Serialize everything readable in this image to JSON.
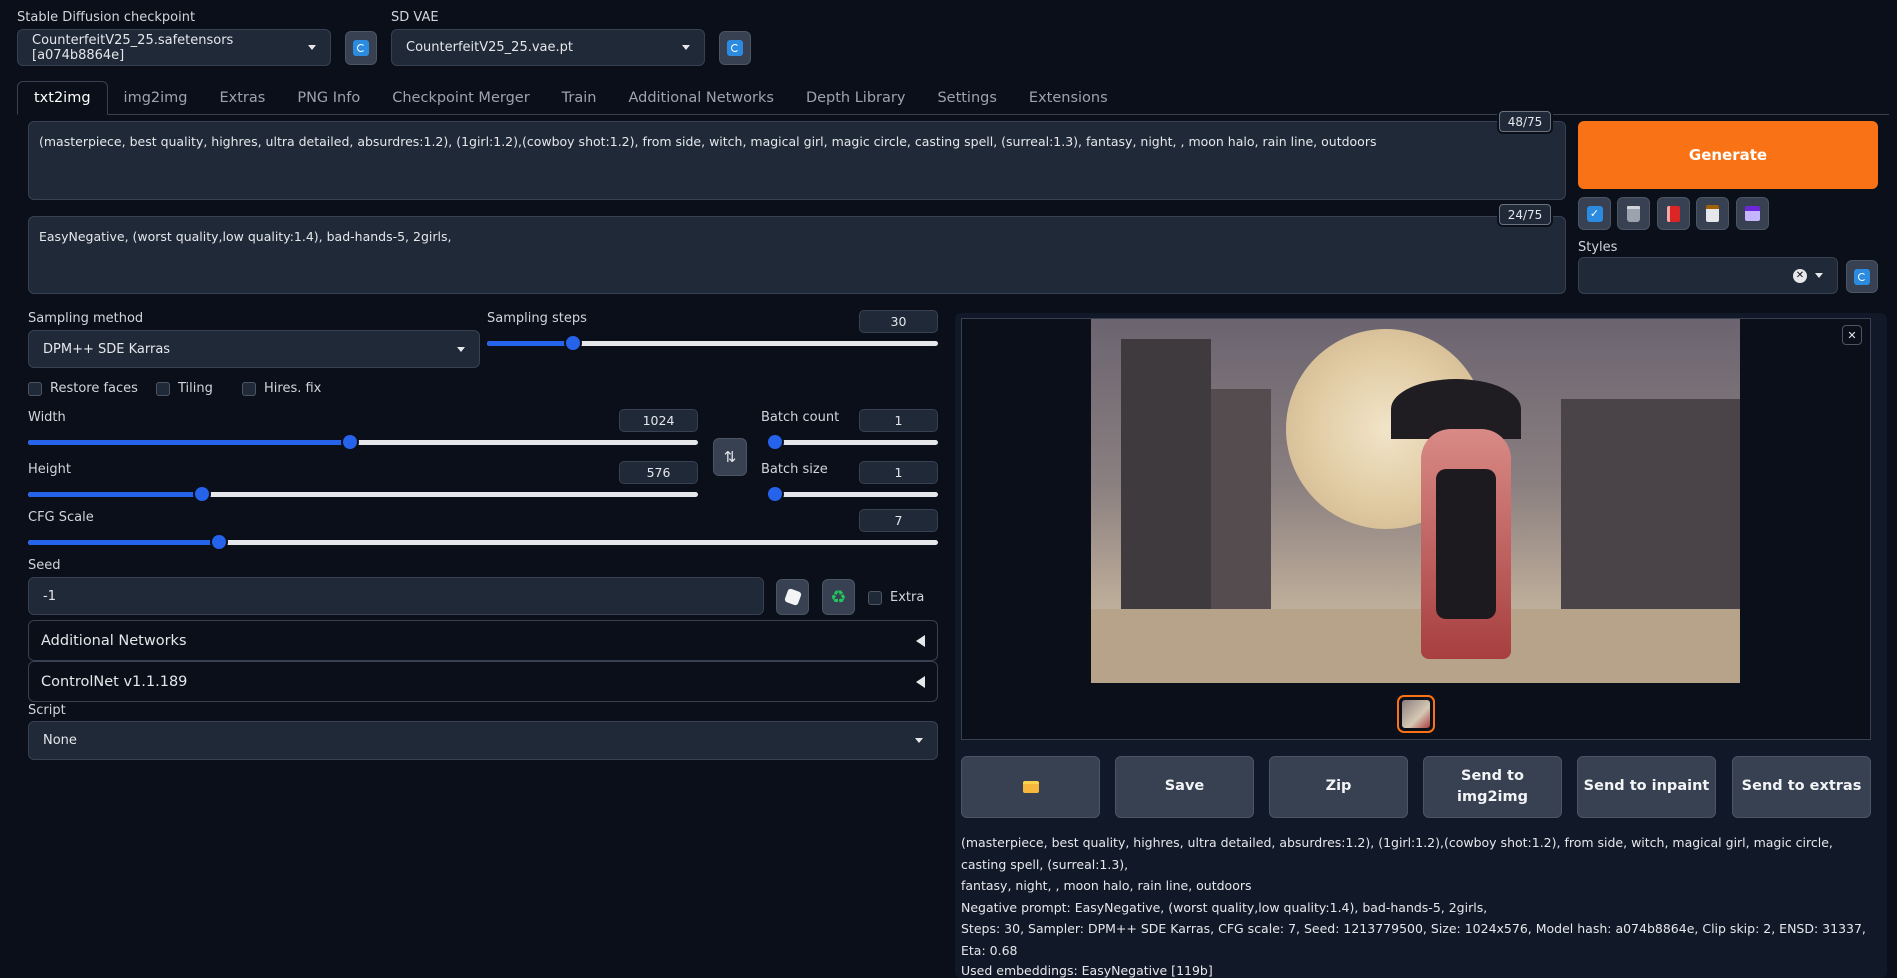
{
  "checkpoint": {
    "label": "Stable Diffusion checkpoint",
    "value": "CounterfeitV25_25.safetensors [a074b8864e]"
  },
  "vae": {
    "label": "SD VAE",
    "value": "CounterfeitV25_25.vae.pt"
  },
  "tabs": [
    "txt2img",
    "img2img",
    "Extras",
    "PNG Info",
    "Checkpoint Merger",
    "Train",
    "Additional Networks",
    "Depth Library",
    "Settings",
    "Extensions"
  ],
  "prompt": {
    "text": "(masterpiece, best quality,  highres,  ultra detailed, absurdres:1.2), (1girl:1.2),(cowboy shot:1.2), from side, witch,  magical girl,  magic circle,  casting spell, (surreal:1.3), fantasy, night, , moon halo, rain line,  outdoors",
    "counter": "48/75"
  },
  "negative_prompt": {
    "text": "EasyNegative, (worst quality,low quality:1.4), bad-hands-5, 2girls,",
    "counter": "24/75"
  },
  "generate_label": "Generate",
  "styles_label": "Styles",
  "sampling_method": {
    "label": "Sampling method",
    "value": "DPM++ SDE Karras"
  },
  "sampling_steps": {
    "label": "Sampling steps",
    "value": "30",
    "fraction": 0.19
  },
  "checkboxes": {
    "restore_faces": "Restore faces",
    "tiling": "Tiling",
    "hires_fix": "Hires. fix"
  },
  "width": {
    "label": "Width",
    "value": "1024",
    "fraction": 0.48
  },
  "height": {
    "label": "Height",
    "value": "576",
    "fraction": 0.26
  },
  "batch_count": {
    "label": "Batch count",
    "value": "1",
    "fraction": 0.0
  },
  "batch_size": {
    "label": "Batch size",
    "value": "1",
    "fraction": 0.0
  },
  "cfg_scale": {
    "label": "CFG Scale",
    "value": "7",
    "fraction": 0.21
  },
  "seed": {
    "label": "Seed",
    "value": "-1",
    "extra_label": "Extra"
  },
  "accordions": {
    "additional_networks": "Additional Networks",
    "controlnet": "ControlNet v1.1.189"
  },
  "script": {
    "label": "Script",
    "value": "None"
  },
  "output_buttons": {
    "save": "Save",
    "zip": "Zip",
    "send_img2img": "Send to img2img",
    "send_inpaint": "Send to inpaint",
    "send_extras": "Send to extras"
  },
  "generation_info": {
    "line1": "(masterpiece, best quality, highres, ultra detailed, absurdres:1.2), (1girl:1.2),(cowboy shot:1.2), from side, witch, magical girl, magic circle, casting spell, (surreal:1.3),",
    "line2": "fantasy, night, , moon halo, rain line, outdoors",
    "line3": "Negative prompt: EasyNegative, (worst quality,low quality:1.4), bad-hands-5, 2girls,",
    "line4": "Steps: 30, Sampler: DPM++ SDE Karras, CFG scale: 7, Seed: 1213779500, Size: 1024x576, Model hash: a074b8864e, Clip skip: 2, ENSD: 31337, Eta: 0.68",
    "embeddings": "Used embeddings: EasyNegative [119b]"
  },
  "colors": {
    "accent": "#2563eb",
    "generate": "#f97316",
    "background": "#0b0f19",
    "panel": "#1f2937"
  }
}
